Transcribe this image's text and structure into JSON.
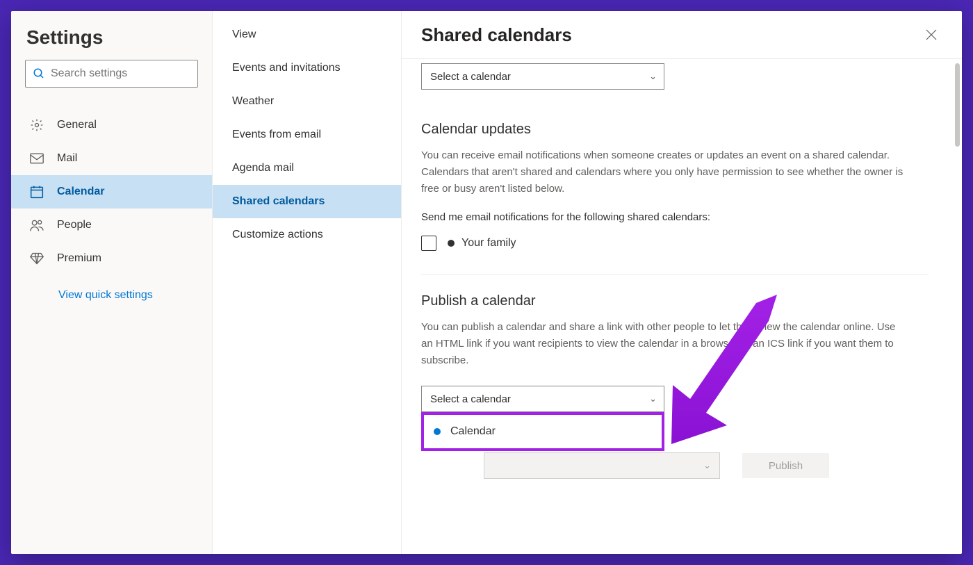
{
  "title": "Settings",
  "search": {
    "placeholder": "Search settings"
  },
  "nav": {
    "general": "General",
    "mail": "Mail",
    "calendar": "Calendar",
    "people": "People",
    "premium": "Premium",
    "quick": "View quick settings"
  },
  "subnav": {
    "view": "View",
    "events_invites": "Events and invitations",
    "weather": "Weather",
    "events_email": "Events from email",
    "agenda": "Agenda mail",
    "shared": "Shared calendars",
    "customize": "Customize actions"
  },
  "page": {
    "heading": "Shared calendars",
    "select_placeholder": "Select a calendar",
    "updates": {
      "h": "Calendar updates",
      "p": "You can receive email notifications when someone creates or updates an event on a shared calendar. Calendars that aren't shared and calendars where you only have permission to see whether the owner is free or busy aren't listed below.",
      "label": "Send me email notifications for the following shared calendars:",
      "item": "Your family"
    },
    "publish": {
      "h": "Publish a calendar",
      "p": "You can publish a calendar and share a link with other people to let them view the calendar online. Use an HTML link if you want recipients to view the calendar in a browser or an ICS link if you want them to subscribe.",
      "button": "Publish",
      "option": "Calendar"
    }
  }
}
